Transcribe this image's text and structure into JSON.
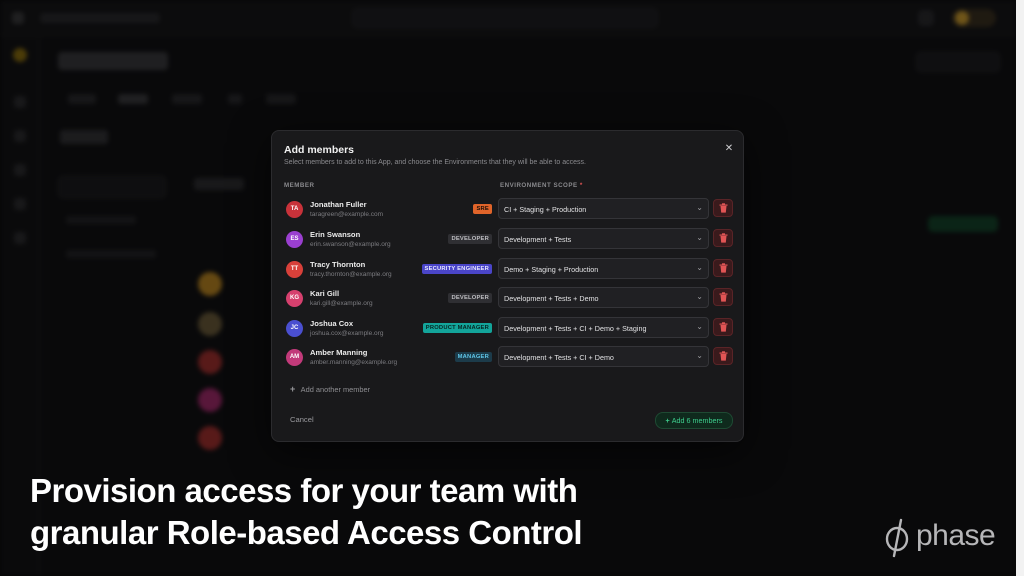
{
  "modal": {
    "title": "Add members",
    "subtitle": "Select members to add to this App, and choose the Environments that they will be able to access.",
    "close_glyph": "✕",
    "col_member": "MEMBER",
    "col_env": "ENVIRONMENT SCOPE",
    "required_mark": "*",
    "members": [
      {
        "initials": "TA",
        "name": "Jonathan Fuller",
        "email": "taragreen@example.com",
        "role": "SRE",
        "env": "CI + Staging + Production",
        "avatar_color": "#c8323a",
        "role_bg": "#e0642a",
        "role_fg": "#1a0f08"
      },
      {
        "initials": "ES",
        "name": "Erin Swanson",
        "email": "erin.swanson@example.org",
        "role": "DEVELOPER",
        "env": "Development + Tests",
        "avatar_color": "#9a3fd0",
        "role_bg": "#2f2f33",
        "role_fg": "#bdbdc1"
      },
      {
        "initials": "TT",
        "name": "Tracy Thornton",
        "email": "tracy.thornton@example.org",
        "role": "SECURITY ENGINEER",
        "env": "Demo + Staging + Production",
        "avatar_color": "#d8403a",
        "role_bg": "#4a45c8",
        "role_fg": "#e8e8ff"
      },
      {
        "initials": "KG",
        "name": "Kari Gill",
        "email": "kari.gill@example.org",
        "role": "DEVELOPER",
        "env": "Development + Tests + Demo",
        "avatar_color": "#d6406e",
        "role_bg": "#2f2f33",
        "role_fg": "#bdbdc1"
      },
      {
        "initials": "JC",
        "name": "Joshua Cox",
        "email": "joshua.cox@example.org",
        "role": "PRODUCT MANAGER",
        "env": "Development + Tests + CI + Demo + Staging",
        "avatar_color": "#4a4fd0",
        "role_bg": "#13a49a",
        "role_fg": "#062623"
      },
      {
        "initials": "AM",
        "name": "Amber Manning",
        "email": "amber.manning@example.org",
        "role": "MANAGER",
        "env": "Development + Tests + CI + Demo",
        "avatar_color": "#c23a7a",
        "role_bg": "#1c3b4a",
        "role_fg": "#5fc4e6"
      }
    ],
    "add_another": "Add another member",
    "cancel": "Cancel",
    "submit": "Add 6 members"
  },
  "caption": {
    "line1": "Provision access for your team with",
    "line2": "granular Role-based Access Control"
  },
  "brand": {
    "name": "phase",
    "logo_icon": "phase-logo-icon"
  },
  "icons": {
    "chevron": "chevron-down-icon",
    "delete": "trash-icon",
    "add": "plus-icon",
    "close": "close-icon"
  },
  "colors": {
    "accent_green": "#3ecf8e",
    "danger": "#e25555",
    "modal_bg": "#19191b"
  }
}
